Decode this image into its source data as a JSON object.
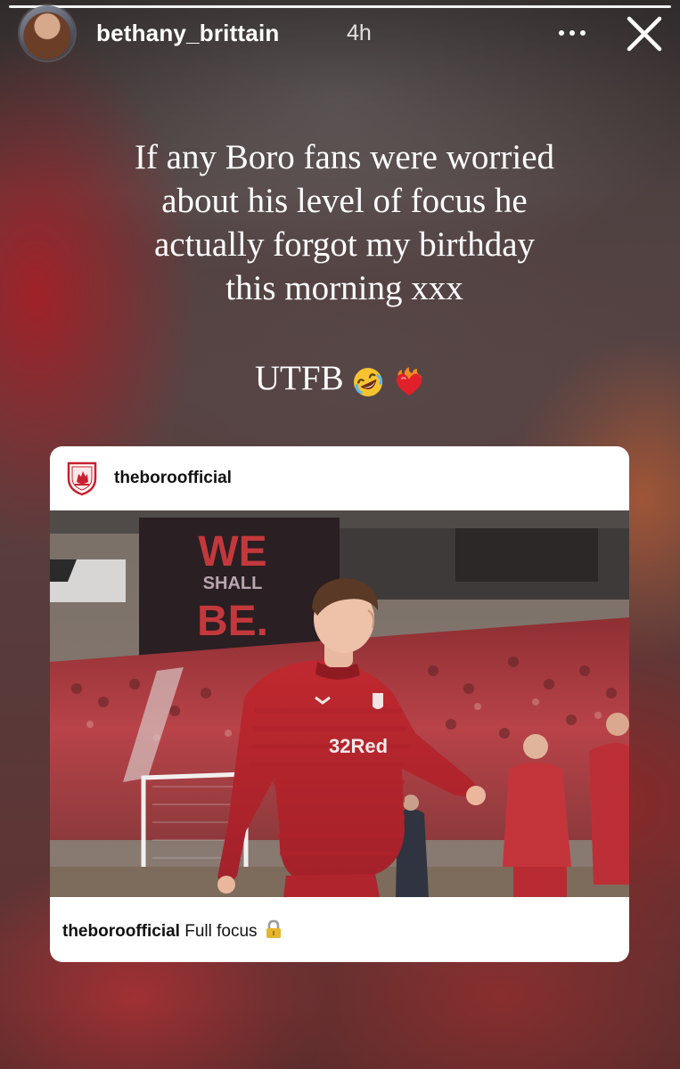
{
  "story": {
    "progress": 1.0,
    "user": {
      "username": "bethany_brittain",
      "time": "4h"
    },
    "icons": {
      "avatar": "profile-avatar",
      "more": "more-options-icon",
      "close": "close-icon"
    },
    "caption_lines": [
      "If any Boro fans were worried",
      "about his level of focus he",
      "actually forgot my birthday",
      "this morning xxx"
    ],
    "tag": "UTFB",
    "emojis": [
      "rolling-on-floor-laughing-emoji",
      "heart-on-fire-emoji"
    ]
  },
  "shared_post": {
    "account": "theboroofficial",
    "crest_icon": "middlesbrough-crest-icon",
    "photo": {
      "board_lines": [
        "WE",
        "SHALL",
        "BE."
      ],
      "shirt_sponsor": "32Red"
    },
    "caption_account": "theboroofficial",
    "caption_text": "Full focus",
    "caption_emoji": "locked-emoji"
  },
  "colors": {
    "club_red": "#c8202e",
    "card_bg": "#ffffff"
  }
}
